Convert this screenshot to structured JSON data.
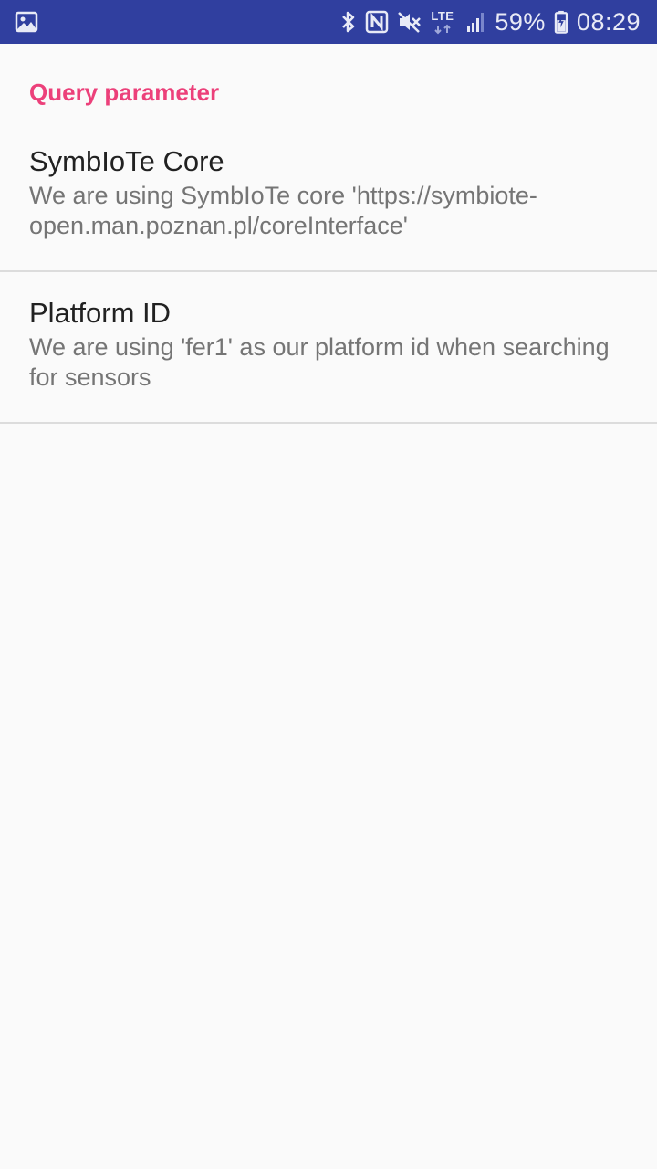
{
  "status_bar": {
    "battery_percent": "59%",
    "time": "08:29",
    "network_label": "LTE",
    "icons": [
      "image-notification-icon",
      "bluetooth-icon",
      "nfc-icon",
      "mute-icon",
      "lte-icon",
      "signal-icon",
      "battery-icon"
    ],
    "background_color": "#303f9f"
  },
  "settings": {
    "category_title": "Query parameter",
    "accent_color": "#ec407a",
    "items": [
      {
        "title": "SymbIoTe Core",
        "summary": "We are using SymbIoTe core 'https://symbiote-open.man.poznan.pl/coreInterface'"
      },
      {
        "title": "Platform ID",
        "summary": "We are using 'fer1' as our platform id when searching for sensors"
      }
    ]
  }
}
